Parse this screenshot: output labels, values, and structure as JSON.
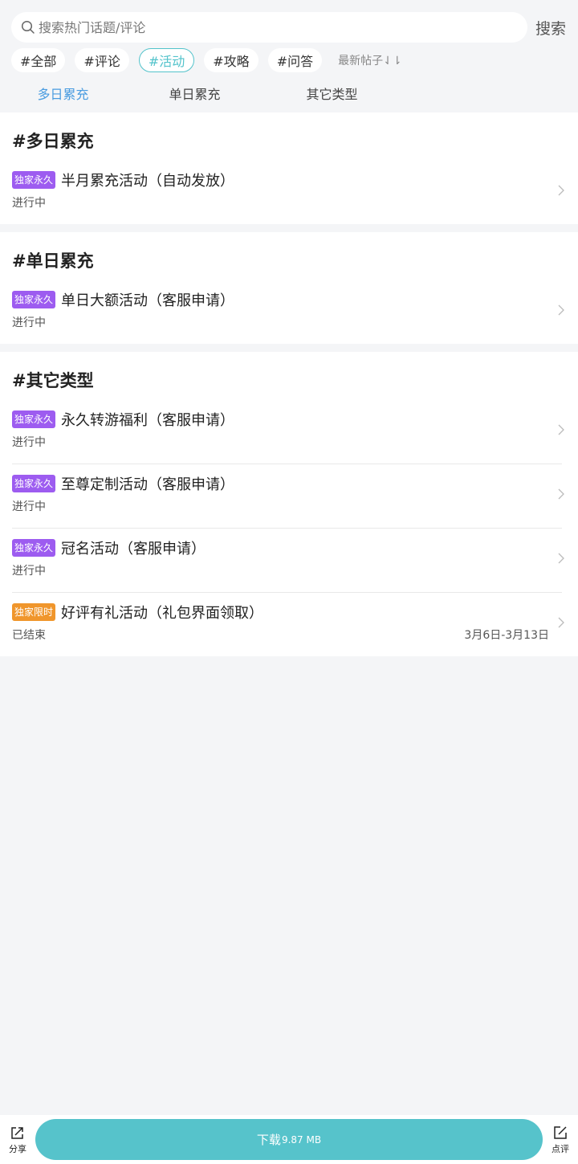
{
  "search": {
    "placeholder": "搜索热门话题/评论",
    "button": "搜索"
  },
  "chips": [
    {
      "label": "#全部",
      "active": false
    },
    {
      "label": "#评论",
      "active": false
    },
    {
      "label": "#活动",
      "active": true
    },
    {
      "label": "#攻略",
      "active": false
    },
    {
      "label": "#问答",
      "active": false
    }
  ],
  "sort_label": "最新帖子⇃⇂",
  "subtabs": [
    {
      "label": "多日累充",
      "active": true
    },
    {
      "label": "单日累充",
      "active": false
    },
    {
      "label": "其它类型",
      "active": false
    }
  ],
  "sections": [
    {
      "title": "#多日累充",
      "items": [
        {
          "badge": "独家永久",
          "badge_color": "#9d5cf0",
          "title": "半月累充活动（自动发放）",
          "status": "进行中",
          "date": ""
        }
      ]
    },
    {
      "title": "#单日累充",
      "items": [
        {
          "badge": "独家永久",
          "badge_color": "#9d5cf0",
          "title": "单日大额活动（客服申请）",
          "status": "进行中",
          "date": ""
        }
      ]
    },
    {
      "title": "#其它类型",
      "items": [
        {
          "badge": "独家永久",
          "badge_color": "#9d5cf0",
          "title": "永久转游福利（客服申请）",
          "status": "进行中",
          "date": ""
        },
        {
          "badge": "独家永久",
          "badge_color": "#9d5cf0",
          "title": "至尊定制活动（客服申请）",
          "status": "进行中",
          "date": ""
        },
        {
          "badge": "独家永久",
          "badge_color": "#9d5cf0",
          "title": "冠名活动（客服申请）",
          "status": "进行中",
          "date": ""
        },
        {
          "badge": "独家限时",
          "badge_color": "#f0962c",
          "title": "好评有礼活动（礼包界面领取）",
          "status": "已结束",
          "date": "3月6日-3月13日"
        }
      ]
    }
  ],
  "bottom": {
    "share": "分享",
    "download": "下载",
    "download_size": "9.87 MB",
    "review": "点评"
  },
  "colors": {
    "accent": "#53c3cb",
    "tab_active": "#4a9ce0",
    "badge_permanent": "#9d5cf0",
    "badge_limited": "#f0962c"
  }
}
